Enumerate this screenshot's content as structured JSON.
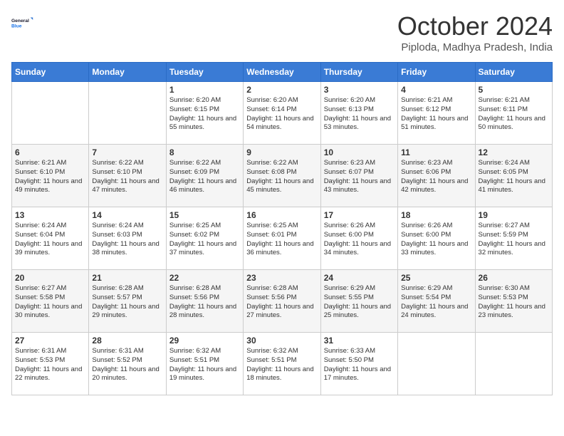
{
  "logo": {
    "line1": "General",
    "line2": "Blue"
  },
  "title": "October 2024",
  "location": "Piploda, Madhya Pradesh, India",
  "days_header": [
    "Sunday",
    "Monday",
    "Tuesday",
    "Wednesday",
    "Thursday",
    "Friday",
    "Saturday"
  ],
  "weeks": [
    [
      {
        "day": "",
        "sunrise": "",
        "sunset": "",
        "daylight": ""
      },
      {
        "day": "",
        "sunrise": "",
        "sunset": "",
        "daylight": ""
      },
      {
        "day": "1",
        "sunrise": "Sunrise: 6:20 AM",
        "sunset": "Sunset: 6:15 PM",
        "daylight": "Daylight: 11 hours and 55 minutes."
      },
      {
        "day": "2",
        "sunrise": "Sunrise: 6:20 AM",
        "sunset": "Sunset: 6:14 PM",
        "daylight": "Daylight: 11 hours and 54 minutes."
      },
      {
        "day": "3",
        "sunrise": "Sunrise: 6:20 AM",
        "sunset": "Sunset: 6:13 PM",
        "daylight": "Daylight: 11 hours and 53 minutes."
      },
      {
        "day": "4",
        "sunrise": "Sunrise: 6:21 AM",
        "sunset": "Sunset: 6:12 PM",
        "daylight": "Daylight: 11 hours and 51 minutes."
      },
      {
        "day": "5",
        "sunrise": "Sunrise: 6:21 AM",
        "sunset": "Sunset: 6:11 PM",
        "daylight": "Daylight: 11 hours and 50 minutes."
      }
    ],
    [
      {
        "day": "6",
        "sunrise": "Sunrise: 6:21 AM",
        "sunset": "Sunset: 6:10 PM",
        "daylight": "Daylight: 11 hours and 49 minutes."
      },
      {
        "day": "7",
        "sunrise": "Sunrise: 6:22 AM",
        "sunset": "Sunset: 6:10 PM",
        "daylight": "Daylight: 11 hours and 47 minutes."
      },
      {
        "day": "8",
        "sunrise": "Sunrise: 6:22 AM",
        "sunset": "Sunset: 6:09 PM",
        "daylight": "Daylight: 11 hours and 46 minutes."
      },
      {
        "day": "9",
        "sunrise": "Sunrise: 6:22 AM",
        "sunset": "Sunset: 6:08 PM",
        "daylight": "Daylight: 11 hours and 45 minutes."
      },
      {
        "day": "10",
        "sunrise": "Sunrise: 6:23 AM",
        "sunset": "Sunset: 6:07 PM",
        "daylight": "Daylight: 11 hours and 43 minutes."
      },
      {
        "day": "11",
        "sunrise": "Sunrise: 6:23 AM",
        "sunset": "Sunset: 6:06 PM",
        "daylight": "Daylight: 11 hours and 42 minutes."
      },
      {
        "day": "12",
        "sunrise": "Sunrise: 6:24 AM",
        "sunset": "Sunset: 6:05 PM",
        "daylight": "Daylight: 11 hours and 41 minutes."
      }
    ],
    [
      {
        "day": "13",
        "sunrise": "Sunrise: 6:24 AM",
        "sunset": "Sunset: 6:04 PM",
        "daylight": "Daylight: 11 hours and 39 minutes."
      },
      {
        "day": "14",
        "sunrise": "Sunrise: 6:24 AM",
        "sunset": "Sunset: 6:03 PM",
        "daylight": "Daylight: 11 hours and 38 minutes."
      },
      {
        "day": "15",
        "sunrise": "Sunrise: 6:25 AM",
        "sunset": "Sunset: 6:02 PM",
        "daylight": "Daylight: 11 hours and 37 minutes."
      },
      {
        "day": "16",
        "sunrise": "Sunrise: 6:25 AM",
        "sunset": "Sunset: 6:01 PM",
        "daylight": "Daylight: 11 hours and 36 minutes."
      },
      {
        "day": "17",
        "sunrise": "Sunrise: 6:26 AM",
        "sunset": "Sunset: 6:00 PM",
        "daylight": "Daylight: 11 hours and 34 minutes."
      },
      {
        "day": "18",
        "sunrise": "Sunrise: 6:26 AM",
        "sunset": "Sunset: 6:00 PM",
        "daylight": "Daylight: 11 hours and 33 minutes."
      },
      {
        "day": "19",
        "sunrise": "Sunrise: 6:27 AM",
        "sunset": "Sunset: 5:59 PM",
        "daylight": "Daylight: 11 hours and 32 minutes."
      }
    ],
    [
      {
        "day": "20",
        "sunrise": "Sunrise: 6:27 AM",
        "sunset": "Sunset: 5:58 PM",
        "daylight": "Daylight: 11 hours and 30 minutes."
      },
      {
        "day": "21",
        "sunrise": "Sunrise: 6:28 AM",
        "sunset": "Sunset: 5:57 PM",
        "daylight": "Daylight: 11 hours and 29 minutes."
      },
      {
        "day": "22",
        "sunrise": "Sunrise: 6:28 AM",
        "sunset": "Sunset: 5:56 PM",
        "daylight": "Daylight: 11 hours and 28 minutes."
      },
      {
        "day": "23",
        "sunrise": "Sunrise: 6:28 AM",
        "sunset": "Sunset: 5:56 PM",
        "daylight": "Daylight: 11 hours and 27 minutes."
      },
      {
        "day": "24",
        "sunrise": "Sunrise: 6:29 AM",
        "sunset": "Sunset: 5:55 PM",
        "daylight": "Daylight: 11 hours and 25 minutes."
      },
      {
        "day": "25",
        "sunrise": "Sunrise: 6:29 AM",
        "sunset": "Sunset: 5:54 PM",
        "daylight": "Daylight: 11 hours and 24 minutes."
      },
      {
        "day": "26",
        "sunrise": "Sunrise: 6:30 AM",
        "sunset": "Sunset: 5:53 PM",
        "daylight": "Daylight: 11 hours and 23 minutes."
      }
    ],
    [
      {
        "day": "27",
        "sunrise": "Sunrise: 6:31 AM",
        "sunset": "Sunset: 5:53 PM",
        "daylight": "Daylight: 11 hours and 22 minutes."
      },
      {
        "day": "28",
        "sunrise": "Sunrise: 6:31 AM",
        "sunset": "Sunset: 5:52 PM",
        "daylight": "Daylight: 11 hours and 20 minutes."
      },
      {
        "day": "29",
        "sunrise": "Sunrise: 6:32 AM",
        "sunset": "Sunset: 5:51 PM",
        "daylight": "Daylight: 11 hours and 19 minutes."
      },
      {
        "day": "30",
        "sunrise": "Sunrise: 6:32 AM",
        "sunset": "Sunset: 5:51 PM",
        "daylight": "Daylight: 11 hours and 18 minutes."
      },
      {
        "day": "31",
        "sunrise": "Sunrise: 6:33 AM",
        "sunset": "Sunset: 5:50 PM",
        "daylight": "Daylight: 11 hours and 17 minutes."
      },
      {
        "day": "",
        "sunrise": "",
        "sunset": "",
        "daylight": ""
      },
      {
        "day": "",
        "sunrise": "",
        "sunset": "",
        "daylight": ""
      }
    ]
  ]
}
